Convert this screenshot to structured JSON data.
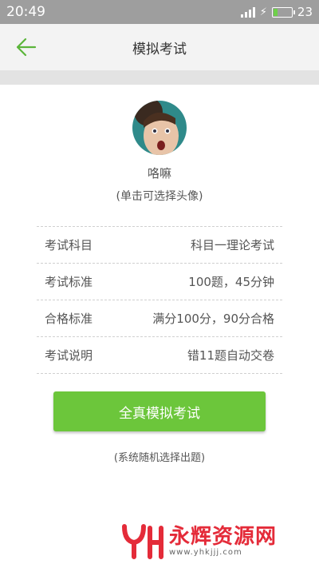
{
  "status_bar": {
    "time": "20:49",
    "battery": "23",
    "battery_level": 0.23
  },
  "app_bar": {
    "title": "模拟考试"
  },
  "profile": {
    "name": "咯嘛",
    "hint": "(单击可选择头像)"
  },
  "info_rows": [
    {
      "label": "考试科目",
      "value": "科目一理论考试"
    },
    {
      "label": "考试标准",
      "value": "100题，45分钟"
    },
    {
      "label": "合格标准",
      "value": "满分100分，90分合格"
    },
    {
      "label": "考试说明",
      "value": "错11题自动交卷"
    }
  ],
  "start_button": {
    "label": "全真模拟考试"
  },
  "footer_note": "(系统随机选择出题)",
  "watermark": {
    "text": "永辉资源网",
    "url": "www.yhkjjj.com"
  },
  "colors": {
    "accent": "#6cc63b",
    "status_bar": "#9e9e9e",
    "watermark": "#e42b39"
  }
}
